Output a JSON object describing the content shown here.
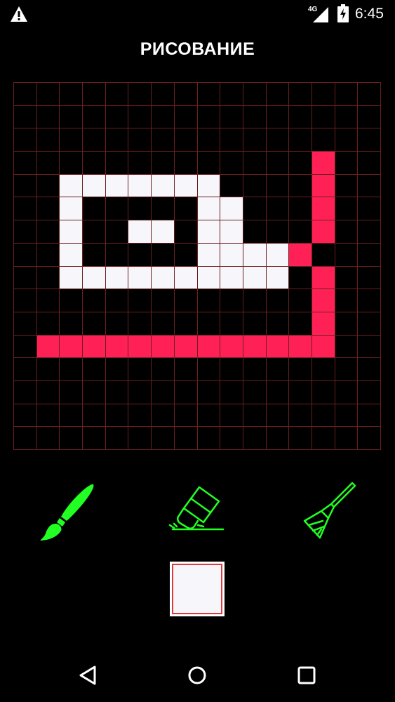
{
  "status_bar": {
    "network": "4G",
    "time": "6:45",
    "icons": [
      "warning-icon",
      "signal-icon",
      "battery-charging-icon"
    ]
  },
  "title": "РИСОВАНИЕ",
  "canvas": {
    "rows": 16,
    "cols": 16,
    "grid_line_color": "#6b1f1f",
    "pixels": [
      "................",
      "................",
      "................",
      ".............R..",
      "..WWWWWWW....R..",
      "..W.....WW...R..",
      "..W..WW.WW...R..",
      "..W.....WWWWR...",
      "..WWWWWWWWWW.R..",
      ".............R..",
      ".............R..",
      ".RRRRRRRRRRRRR..",
      "................",
      "................",
      "................",
      "................"
    ],
    "palette": {
      "W": "#f6f6fb",
      "R": "#ff2155"
    }
  },
  "tools": [
    {
      "name": "brush",
      "icon": "paintbrush-icon",
      "color": "#22ff22"
    },
    {
      "name": "eraser",
      "icon": "eraser-icon",
      "color": "#22ff22"
    },
    {
      "name": "clear",
      "icon": "broom-icon",
      "color": "#22ff22"
    }
  ],
  "current_color": "#f6f6fb",
  "nav": [
    "back-icon",
    "home-icon",
    "recents-icon"
  ]
}
